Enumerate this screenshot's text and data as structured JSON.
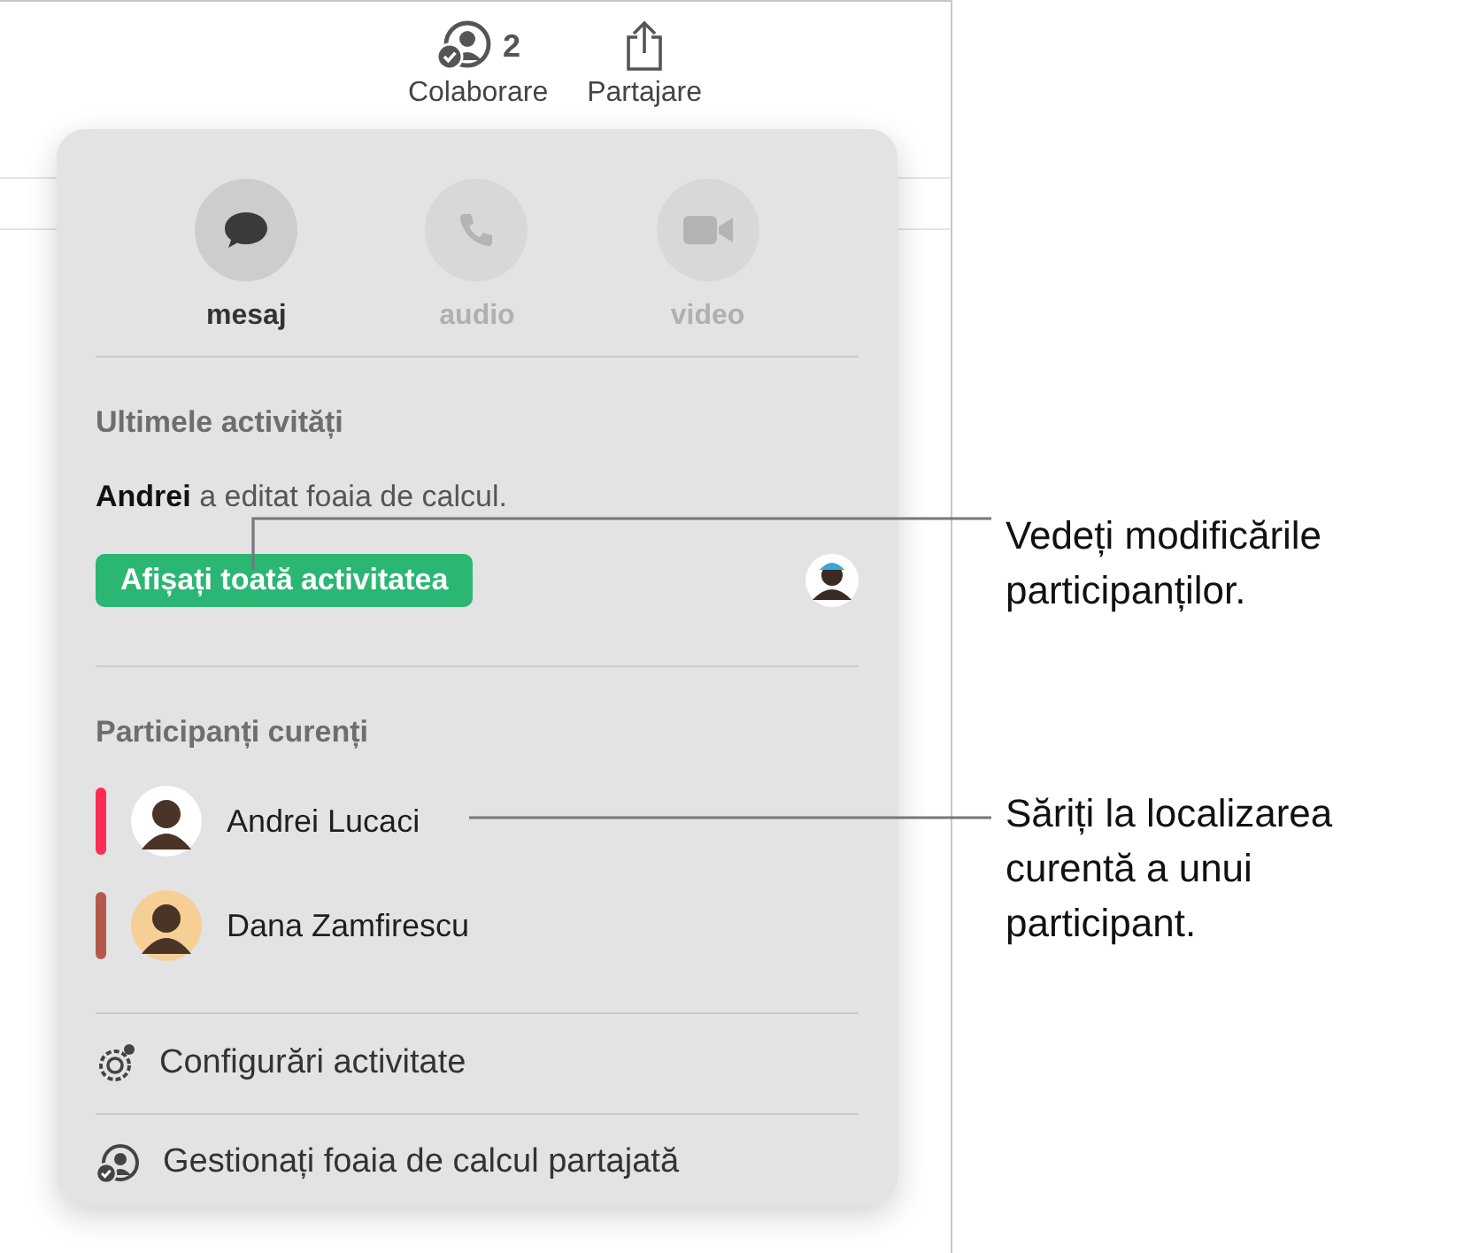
{
  "toolbar": {
    "buttons": [
      {
        "label": "Colaborare",
        "count": "2",
        "kind": "collab"
      },
      {
        "label": "Partajare",
        "kind": "share"
      }
    ]
  },
  "popover": {
    "contact_buttons": [
      {
        "label": "mesaj",
        "disabled": false,
        "kind": "message"
      },
      {
        "label": "audio",
        "disabled": true,
        "kind": "phone"
      },
      {
        "label": "video",
        "disabled": true,
        "kind": "video"
      }
    ],
    "recent_activity": {
      "heading": "Ultimele activități",
      "text": "**Andrei** a editat foaia de calcul.",
      "button": "Afișați toată activitatea"
    },
    "participants": {
      "heading": "Participanți curenți",
      "items": [
        {
          "name": "Andrei Lucaci",
          "color": "#ff2d55"
        },
        {
          "name": "Dana Zamfirescu",
          "color": "#b5584c"
        }
      ]
    },
    "menu": [
      {
        "label": "Configurări activitate",
        "kind": "settings"
      },
      {
        "label": "Gestionați foaia de calcul partajată",
        "kind": "manage"
      }
    ]
  },
  "callouts": [
    "Vedeți modificările participanților.",
    "Săriți la localizarea curentă a unui participant."
  ]
}
